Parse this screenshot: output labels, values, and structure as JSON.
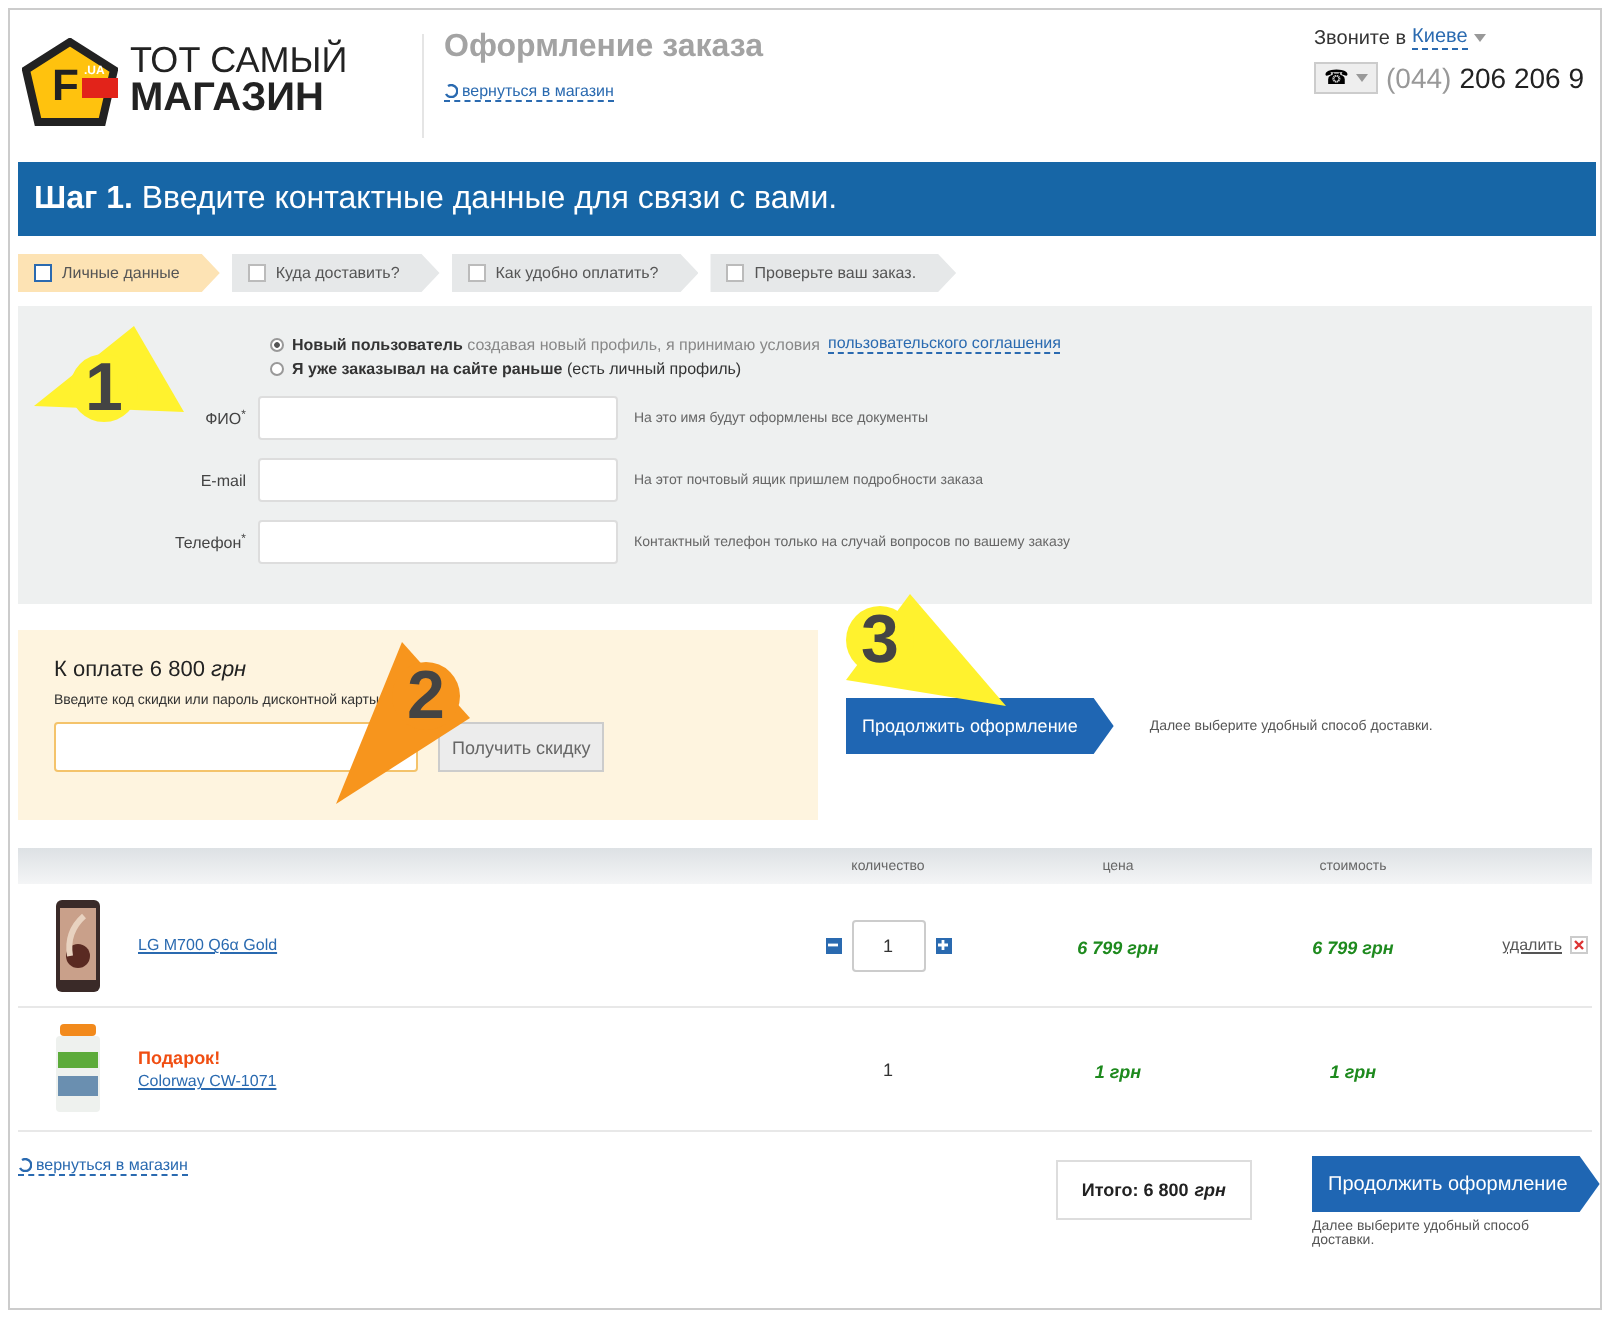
{
  "header": {
    "logo": {
      "letter": "F",
      "badge": ".UA",
      "line1": "ТОТ САМЫЙ",
      "line2": "МАГАЗИН"
    },
    "title": "Оформление заказа",
    "back_link": "вернуться в магазин",
    "call_label": "Звоните в",
    "city": "Киеве",
    "phone_button": "☎",
    "phone_code": "(044)",
    "phone_number": "206 206 9"
  },
  "step_banner": {
    "step": "Шаг 1.",
    "text": "Введите контактные данные для связи с вами."
  },
  "steps": [
    {
      "label": "Личные данные",
      "selected": true
    },
    {
      "label": "Куда доставить?",
      "selected": false
    },
    {
      "label": "Как удобно оплатить?",
      "selected": false
    },
    {
      "label": "Проверьте ваш заказ.",
      "selected": false
    }
  ],
  "user_options": [
    {
      "label": "Новый пользователь",
      "note": "создавая новый профиль, я принимаю условия",
      "link": "пользовательского соглашения",
      "selected": true
    },
    {
      "label": "Я уже заказывал на сайте раньше",
      "note": "(есть личный профиль)",
      "selected": false
    }
  ],
  "fields": [
    {
      "label": "ФИО",
      "mark": "*",
      "hint": "На это имя будут оформлены все документы"
    },
    {
      "label": "E-mail",
      "hint": "На этот почтовый ящик пришлем подробности заказа"
    },
    {
      "label": "Телефон",
      "mark": "*",
      "hint": "Контактный телефон только на случай вопросов по вашему заказу"
    }
  ],
  "payment": {
    "total_label": "К оплате 6 800",
    "currency": "грн",
    "discount_label": "Введите код скидки или пароль дисконтной карты",
    "discount_button": "Получить скидку"
  },
  "continue": {
    "button": "Продолжить оформление",
    "note": "Далее выберите удобный способ доставки."
  },
  "cart": {
    "columns": [
      "количество",
      "цена",
      "стоимость"
    ],
    "rows": [
      {
        "kind": "product",
        "name": "LG M700 Q6α Gold",
        "quantity": "1",
        "price": "6 799 грн",
        "cost": "6 799 грн",
        "remove": "удалить"
      },
      {
        "kind": "gift",
        "gift_label": "Подарок!",
        "name": "Colorway CW-1071",
        "quantity": "1",
        "price": "1 грн",
        "cost": "1 грн"
      }
    ]
  },
  "footer": {
    "back_link": "вернуться в магазин",
    "total": "Итого: 6 800",
    "currency": "грн",
    "button": "Продолжить оформление",
    "note": "Далее выберите удобный способ доставки."
  },
  "annotations": [
    {
      "number": "1",
      "color": "#fff22e"
    },
    {
      "number": "2",
      "color": "#f7951d"
    },
    {
      "number": "3",
      "color": "#fff22e"
    }
  ]
}
